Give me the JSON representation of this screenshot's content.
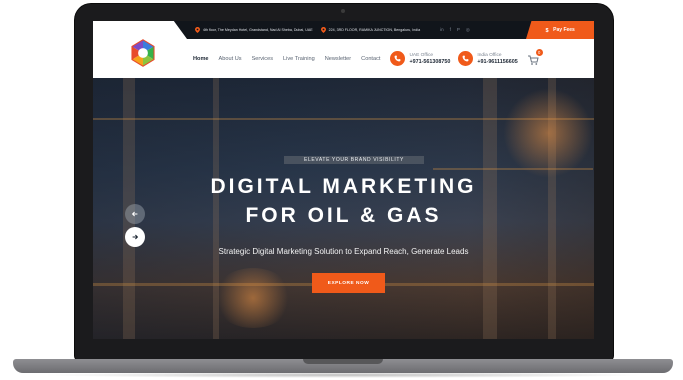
{
  "topbar": {
    "address_1": "4th floor, The Meydan Hotel, Grandstand, Nad Al Sheba, Dubai, UAE",
    "address_2": "224, 3RD FLOOR, RAMIKA JUNCTION, Bengaluru, India",
    "social": [
      {
        "icon": "linkedin-icon",
        "glyph": "in"
      },
      {
        "icon": "facebook-icon",
        "glyph": "f"
      },
      {
        "icon": "pinterest-icon",
        "glyph": "P"
      },
      {
        "icon": "instagram-icon",
        "glyph": "◎"
      }
    ],
    "pay_label": "Pay Fees"
  },
  "nav": {
    "items": [
      "Home",
      "About Us",
      "Services",
      "Live Training",
      "Newsletter",
      "Contact"
    ],
    "active": "Home"
  },
  "offices": [
    {
      "label": "UAE Office",
      "number": "+971-561308750"
    },
    {
      "label": "India Office",
      "number": "+91-9611156605"
    }
  ],
  "cart": {
    "count": "0"
  },
  "hero": {
    "eyebrow": "ELEVATE YOUR BRAND VISIBILITY",
    "title_line_1": "DIGITAL MARKETING",
    "title_line_2": "FOR OIL & GAS",
    "subtitle": "Strategic Digital Marketing Solution to Expand Reach, Generate Leads",
    "cta_label": "EXPLORE NOW"
  },
  "colors": {
    "accent": "#f05a1a",
    "topbar_bg": "#11151b"
  }
}
